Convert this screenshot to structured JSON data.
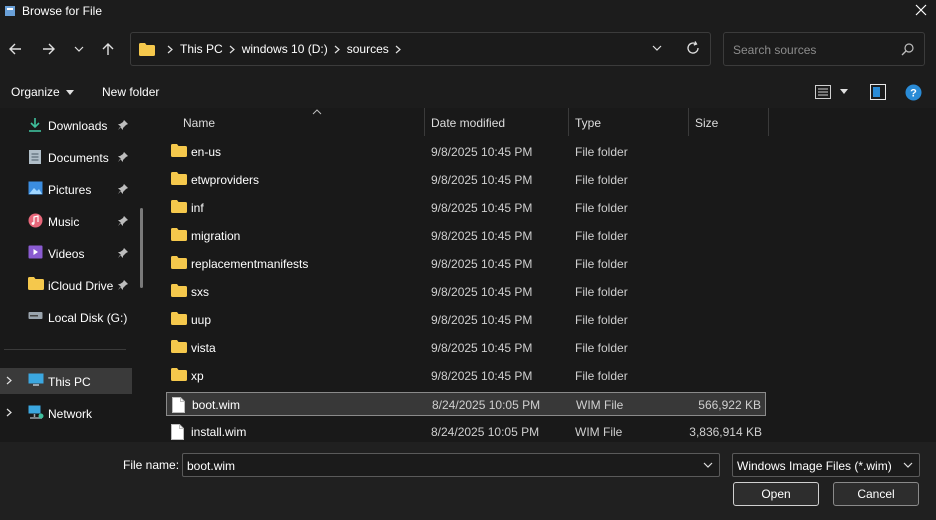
{
  "window": {
    "title": "Browse for File"
  },
  "address": {
    "crumbs": [
      "This PC",
      "windows 10 (D:)",
      "sources"
    ]
  },
  "search": {
    "placeholder": "Search sources"
  },
  "toolbar": {
    "organize_label": "Organize",
    "new_folder_label": "New folder"
  },
  "sidebar": {
    "items": [
      {
        "label": "Downloads",
        "icon": "download-icon",
        "pinned": true
      },
      {
        "label": "Documents",
        "icon": "document-icon",
        "pinned": true
      },
      {
        "label": "Pictures",
        "icon": "picture-icon",
        "pinned": true
      },
      {
        "label": "Music",
        "icon": "music-icon",
        "pinned": true
      },
      {
        "label": "Videos",
        "icon": "video-icon",
        "pinned": true
      },
      {
        "label": "iCloud Drive",
        "icon": "folder-icon",
        "pinned": true
      },
      {
        "label": "Local Disk (G:)",
        "icon": "drive-icon",
        "pinned": false
      },
      {
        "label": "This PC",
        "icon": "computer-icon",
        "selected": true
      },
      {
        "label": "Network",
        "icon": "network-icon"
      }
    ]
  },
  "columns": {
    "name": "Name",
    "date": "Date modified",
    "type": "Type",
    "size": "Size"
  },
  "files": [
    {
      "name": "en-us",
      "date": "9/8/2025 10:45 PM",
      "type": "File folder",
      "size": "",
      "kind": "folder"
    },
    {
      "name": "etwproviders",
      "date": "9/8/2025 10:45 PM",
      "type": "File folder",
      "size": "",
      "kind": "folder"
    },
    {
      "name": "inf",
      "date": "9/8/2025 10:45 PM",
      "type": "File folder",
      "size": "",
      "kind": "folder"
    },
    {
      "name": "migration",
      "date": "9/8/2025 10:45 PM",
      "type": "File folder",
      "size": "",
      "kind": "folder"
    },
    {
      "name": "replacementmanifests",
      "date": "9/8/2025 10:45 PM",
      "type": "File folder",
      "size": "",
      "kind": "folder"
    },
    {
      "name": "sxs",
      "date": "9/8/2025 10:45 PM",
      "type": "File folder",
      "size": "",
      "kind": "folder"
    },
    {
      "name": "uup",
      "date": "9/8/2025 10:45 PM",
      "type": "File folder",
      "size": "",
      "kind": "folder"
    },
    {
      "name": "vista",
      "date": "9/8/2025 10:45 PM",
      "type": "File folder",
      "size": "",
      "kind": "folder"
    },
    {
      "name": "xp",
      "date": "9/8/2025 10:45 PM",
      "type": "File folder",
      "size": "",
      "kind": "folder"
    },
    {
      "name": "boot.wim",
      "date": "8/24/2025 10:05 PM",
      "type": "WIM File",
      "size": "566,922 KB",
      "kind": "file",
      "selected": true
    },
    {
      "name": "install.wim",
      "date": "8/24/2025 10:05 PM",
      "type": "WIM File",
      "size": "3,836,914 KB",
      "kind": "file"
    }
  ],
  "footer": {
    "file_name_label": "File name:",
    "file_name_value": "boot.wim",
    "filter_value": "Windows Image Files (*.wim)",
    "open_label": "Open",
    "cancel_label": "Cancel"
  },
  "colors": {
    "folder": "#f5c84c",
    "accent": "#2a8bd6",
    "background": "#191919"
  }
}
